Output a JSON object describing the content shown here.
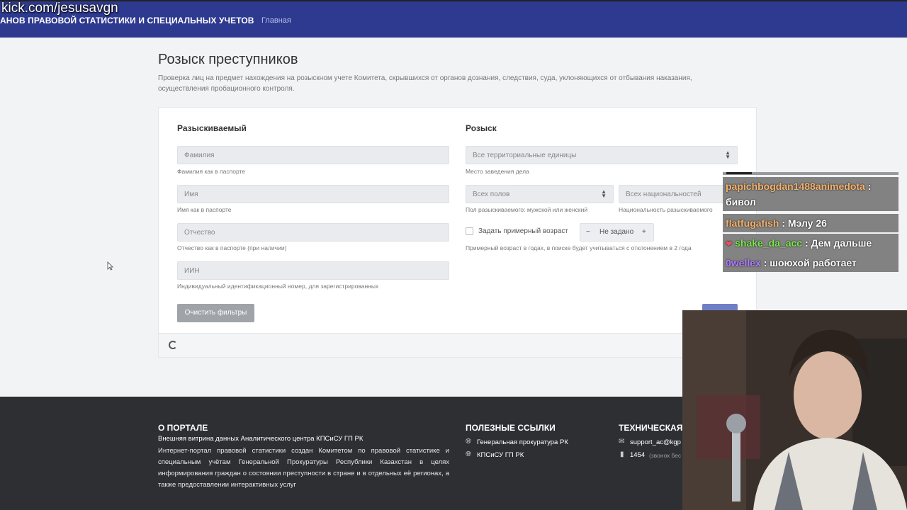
{
  "stream_url": "kick.com/jesusavgn",
  "header": {
    "brand": "АНОВ ПРАВОВОЙ СТАТИСТИКИ И СПЕЦИАЛЬНЫХ УЧЕТОВ",
    "nav_home": "Главная"
  },
  "page": {
    "title": "Розыск преступников",
    "description": "Проверка лиц на предмет нахождения на розыскном учете Комитета, скрывшихся от органов дознания, следствия, суда, уклоняющихся от отбывания наказания, осуществления пробационного контроля."
  },
  "wanted": {
    "title": "Разыскиваемый",
    "surname": {
      "placeholder": "Фамилия",
      "hint": "Фамилия как в паспорте"
    },
    "name": {
      "placeholder": "Имя",
      "hint": "Имя как в паспорте"
    },
    "patronymic": {
      "placeholder": "Отчество",
      "hint": "Отчество как в паспорте (при наличии)"
    },
    "iin": {
      "placeholder": "ИИН",
      "hint": "Индивидуальный идентификационный номер, для зарегистрированных"
    },
    "clear_button": "Очистить фильтры"
  },
  "search": {
    "title": "Розыск",
    "territory": {
      "value": "Все территориальные единицы",
      "hint": "Место заведения дела"
    },
    "gender": {
      "value": "Всех полов",
      "hint": "Пол разыскиваемого: мужской или женский"
    },
    "nationality": {
      "value": "Всех национальностей",
      "hint": "Национальность разыскиваемого"
    },
    "age_checkbox_label": "Задать примерный возраст",
    "age_stepper": {
      "minus": "−",
      "value": "Не задано",
      "plus": "+"
    },
    "age_hint": "Примерный возраст в годах, в поиске будет учитываться с отклонением в 2 года"
  },
  "footer": {
    "about_title": "О ПОРТАЛЕ",
    "about_sub": "Внешняя витрина данных Аналитического центра КПСиСУ ГП РК",
    "about_text": "Интернет-портал правовой статистики создан Комитетом по правовой статистике и специальным учётам Генеральной Прокуратуры Республики Казахстан в целях информирования граждан о состоянии преступности в стране и в отдельных её регионах, а также предоставлении интерактивных услуг",
    "links_title": "ПОЛЕЗНЫЕ ССЫЛКИ",
    "links": [
      "Генеральная прокуратура РК",
      "КПСиСУ ГП РК"
    ],
    "support_title": "ТЕХНИЧЕСКАЯ",
    "support_email": "support_ac@kgp",
    "support_phone": "1454",
    "support_phone_note": "(звонок бес"
  },
  "chat": [
    {
      "user": "papichbogdan1488animedota",
      "sep": " :",
      "text": "бивол"
    },
    {
      "user": "flatfugafish",
      "sep": " : ",
      "text": "Мэлу 26"
    },
    {
      "user": "shake_da_acc",
      "sep": " : ",
      "text": "Дем дальше"
    },
    {
      "user": "0wellex",
      "sep": " : ",
      "text": "шоюхой работает"
    }
  ],
  "icons": {
    "sort": "sort-arrows-icon",
    "globe": "globe-icon",
    "mail": "mail-icon",
    "phone": "phone-icon",
    "heart": "heart-icon",
    "spinner": "spinner-icon"
  }
}
